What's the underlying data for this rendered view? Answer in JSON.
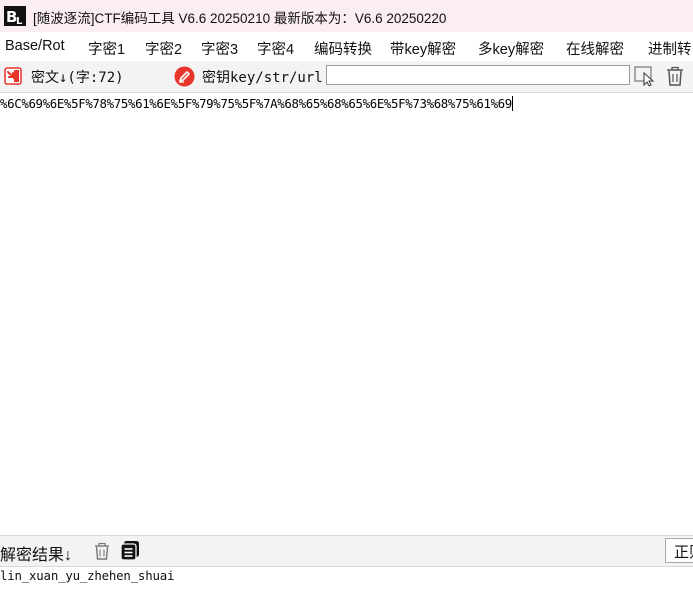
{
  "window": {
    "title": "[随波逐流]CTF编码工具 V6.6 20250210    最新版本为：V6.6 20250220"
  },
  "menu": {
    "items": [
      {
        "label": "Base/Rot"
      },
      {
        "label": "字密1"
      },
      {
        "label": "字密2"
      },
      {
        "label": "字密3"
      },
      {
        "label": "字密4"
      },
      {
        "label": "编码转换"
      },
      {
        "label": "带key解密"
      },
      {
        "label": "多key解密"
      },
      {
        "label": "在线解密"
      },
      {
        "label": "进制转"
      }
    ]
  },
  "toolbar": {
    "cipher_label": "密文↓(字:72)",
    "key_label": "密钥key/str/url:",
    "key_value": ""
  },
  "cipher": {
    "text": "%6C%69%6E%5F%78%75%61%6E%5F%79%75%5F%7A%68%65%68%65%6E%5F%73%68%75%61%69"
  },
  "result": {
    "label": "解密结果↓",
    "button_label": "正则",
    "text": "lin_xuan_yu_zhehen_shuai"
  },
  "colors": {
    "titlebar_bg": "#fbeef2",
    "accent_red": "#e8352b",
    "toolbar_bg": "#f3f3f3"
  }
}
